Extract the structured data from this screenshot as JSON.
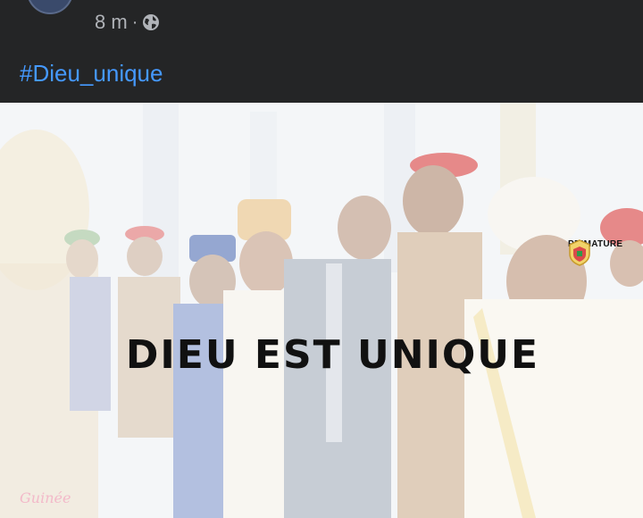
{
  "post": {
    "time": "8 m",
    "separator": "·",
    "privacy_icon": "globe-icon",
    "hashtag": "#Dieu_unique"
  },
  "image": {
    "caption": "DIEU EST UNIQUE",
    "logo_text": "PRIMATURE",
    "watermark": "Guinée"
  },
  "colors": {
    "header_bg": "#242526",
    "hashtag": "#4599ff",
    "meta_text": "#b0b3b8",
    "beret_red": "#d94a4a"
  }
}
